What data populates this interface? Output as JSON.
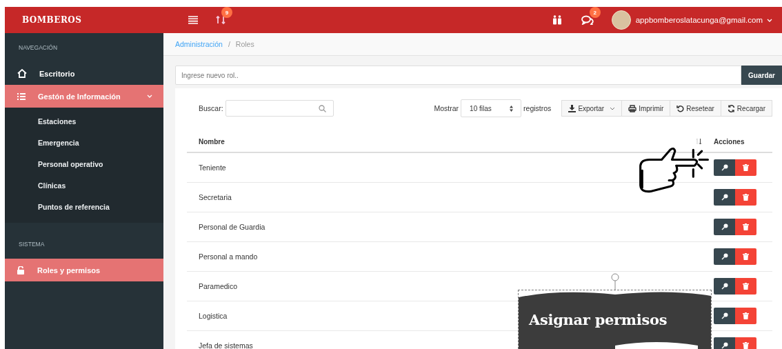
{
  "header": {
    "brand": "BOMBEROS",
    "notifications_badge": "9",
    "messages_badge": "2",
    "user_email": "appbomberoslatacunga@gmail.com"
  },
  "sidebar": {
    "sections": [
      {
        "title": "NAVEGACIÓN",
        "items": [
          {
            "label": "Escritorio",
            "selected": false
          },
          {
            "label": "Gestón de Información",
            "selected": true,
            "expanded": true,
            "children": [
              {
                "label": "Estaciones"
              },
              {
                "label": "Emergencia"
              },
              {
                "label": "Personal operativo"
              },
              {
                "label": "Clínicas"
              },
              {
                "label": "Puntos de referencia"
              }
            ]
          }
        ]
      },
      {
        "title": "SISTEMA",
        "items": [
          {
            "label": "Roles y permisos",
            "selected": true
          }
        ]
      }
    ]
  },
  "breadcrumb": {
    "items": [
      "Administración",
      "Roles"
    ],
    "separator": "/"
  },
  "new_role": {
    "placeholder": "Ingrese nuevo rol..",
    "button": "Guardar"
  },
  "table_tools": {
    "search_label": "Buscar:",
    "show_label": "Mostrar",
    "page_size": "10 filas",
    "records_label": "registros",
    "buttons": [
      "Exportar",
      "Imprimir",
      "Resetear",
      "Recargar"
    ]
  },
  "table": {
    "columns": [
      "Nombre",
      "Acciones"
    ],
    "rows": [
      {
        "name": "Teniente"
      },
      {
        "name": "Secretaria"
      },
      {
        "name": "Personal de Guardia"
      },
      {
        "name": "Personal a mando"
      },
      {
        "name": "Paramedico"
      },
      {
        "name": "Logistica"
      },
      {
        "name": "Jefa de sistemas"
      }
    ]
  },
  "callout": {
    "text": "Asignar permisos"
  }
}
